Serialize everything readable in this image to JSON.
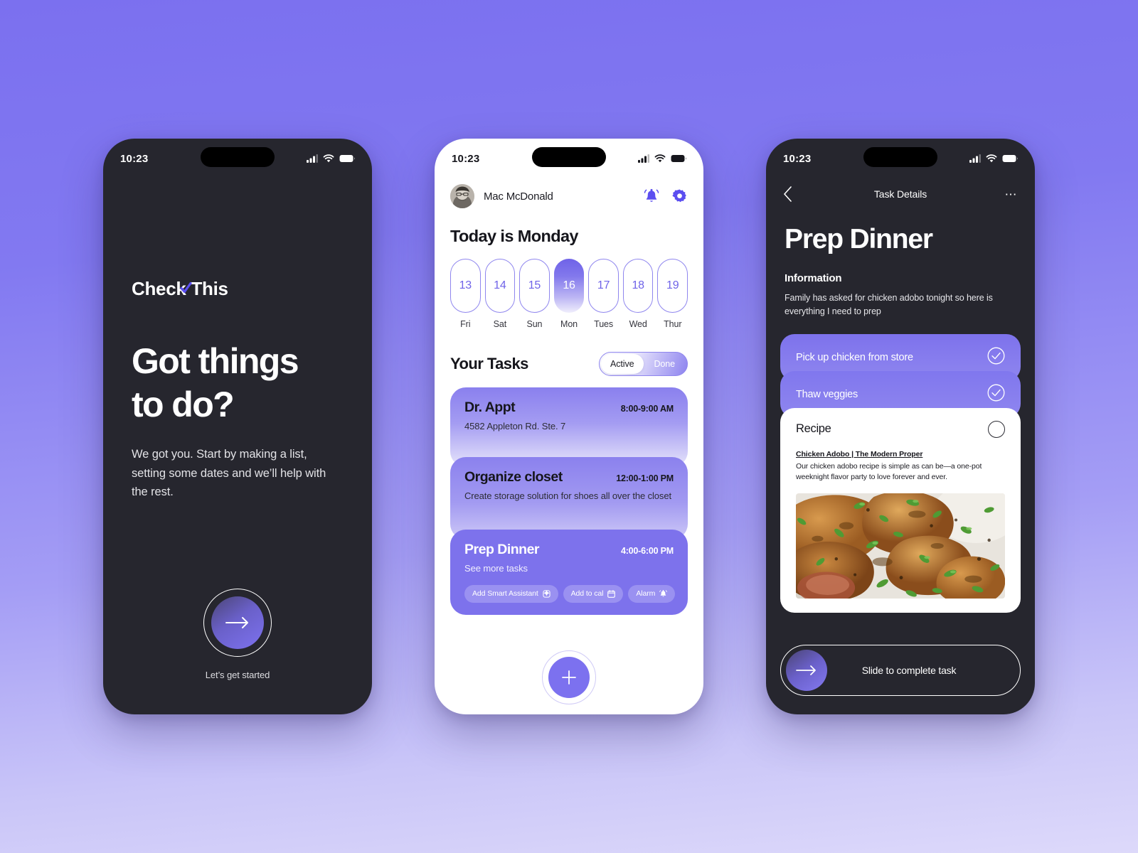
{
  "theme": {
    "accent": "#7c71ef",
    "accent_light": "#8f86ee",
    "dark_bg": "#26262e",
    "page_bg_top": "#7b70ef",
    "page_bg_bottom": "#ddd9fa"
  },
  "status_bar": {
    "time": "10:23",
    "icons": [
      "cellular-signal-icon",
      "wifi-icon",
      "battery-icon"
    ]
  },
  "screen_onboarding": {
    "brand": "Check This",
    "brand_check_icon": "checkmark-icon",
    "headline_line1": "Got things",
    "headline_line2": "to do?",
    "body": "We got you. Start by making a list, setting some dates and we’ll help with the rest.",
    "cta_icon": "arrow-right-icon",
    "cta_label": "Let’s get started"
  },
  "screen_home": {
    "user_name": "Mac McDonald",
    "avatar": "user-avatar",
    "notification_icon": "bell-icon",
    "settings_icon": "gear-icon",
    "greeting": "Today is Monday",
    "dates": [
      {
        "num": "13",
        "day": "Fri",
        "selected": false
      },
      {
        "num": "14",
        "day": "Sat",
        "selected": false
      },
      {
        "num": "15",
        "day": "Sun",
        "selected": false
      },
      {
        "num": "16",
        "day": "Mon",
        "selected": true
      },
      {
        "num": "17",
        "day": "Tues",
        "selected": false
      },
      {
        "num": "18",
        "day": "Wed",
        "selected": false
      },
      {
        "num": "19",
        "day": "Thur",
        "selected": false
      }
    ],
    "tasks_title": "Your Tasks",
    "filter": {
      "active_label": "Active",
      "done_label": "Done",
      "selected": "Active"
    },
    "tasks": [
      {
        "title": "Dr. Appt",
        "subtitle": "4582 Appleton Rd. Ste. 7",
        "time": "8:00-9:00 AM"
      },
      {
        "title": "Organize closet",
        "subtitle": "Create storage solution for shoes all over the closet",
        "time": "12:00-1:00 PM"
      },
      {
        "title": "Prep Dinner",
        "subtitle": "See more tasks",
        "time": "4:00-6:00 PM"
      }
    ],
    "chips": [
      {
        "label": "Add Smart Assistant",
        "icon": "sparkle-icon"
      },
      {
        "label": "Add to cal",
        "icon": "calendar-icon"
      },
      {
        "label": "Alarm",
        "icon": "bell-icon"
      }
    ],
    "fab_icon": "plus-icon"
  },
  "screen_detail": {
    "back_icon": "chevron-left-icon",
    "nav_title": "Task Details",
    "more_icon": "ellipsis-icon",
    "heading": "Prep Dinner",
    "section_label": "Information",
    "information": "Family has asked for chicken adobo tonight so here is everything I need to prep",
    "checklist": [
      {
        "label": "Pick up chicken from store",
        "checked": true,
        "icon": "check-circle-icon"
      },
      {
        "label": "Thaw veggies",
        "checked": true,
        "icon": "check-circle-icon"
      }
    ],
    "recipe": {
      "title": "Recipe",
      "checked": false,
      "check_icon": "empty-circle-icon",
      "link": "Chicken Adobo | The Modern Proper",
      "description": "Our chicken adobo recipe is simple as can be—a one-pot weeknight flavor party to love forever and ever.",
      "photo": "chicken-adobo-photo"
    },
    "slider": {
      "label": "Slide to complete task",
      "icon": "arrow-right-icon"
    }
  }
}
